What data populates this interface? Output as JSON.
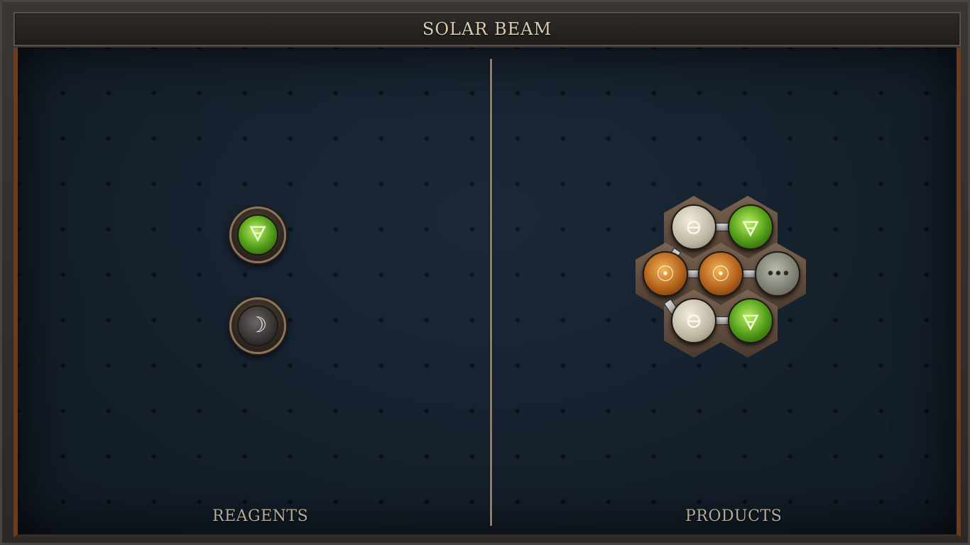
{
  "title": "SOLAR BEAM",
  "reagents": {
    "label": "REAGENTS",
    "items": [
      {
        "element": "earth",
        "glyph": "🜃"
      },
      {
        "element": "moon",
        "glyph": "☽"
      }
    ]
  },
  "products": {
    "label": "PRODUCTS",
    "atoms": [
      {
        "element": "salt",
        "glyph": "⊖"
      },
      {
        "element": "earth",
        "glyph": "🜃"
      },
      {
        "element": "fire",
        "glyph": "☉"
      },
      {
        "element": "fire",
        "glyph": "☉"
      },
      {
        "element": "quintessence",
        "glyph": "•••"
      },
      {
        "element": "salt",
        "glyph": "⊖"
      },
      {
        "element": "earth",
        "glyph": "🜃"
      }
    ]
  },
  "colors": {
    "board": "#15202c",
    "frame": "#2a2725",
    "copper_trim": "#6b3c1f",
    "label_text": "#b6ab9b",
    "title_text": "#d9ccb4"
  }
}
